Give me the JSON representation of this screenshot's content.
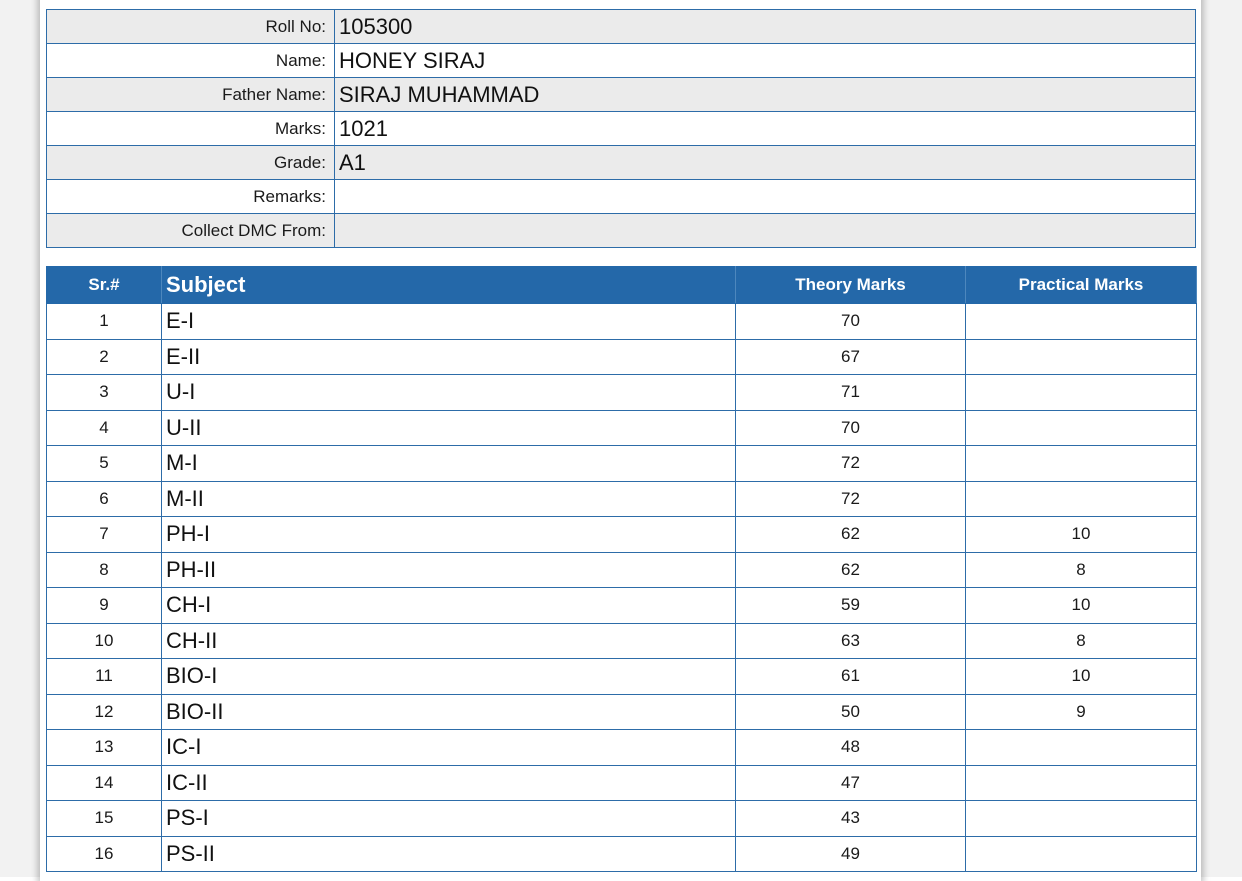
{
  "student": {
    "roll_no_label": "Roll No:",
    "roll_no": "105300",
    "name_label": "Name:",
    "name": "HONEY SIRAJ",
    "father_name_label": "Father Name:",
    "father_name": "SIRAJ MUHAMMAD",
    "marks_label": "Marks:",
    "marks": "1021",
    "grade_label": "Grade:",
    "grade": "A1",
    "remarks_label": "Remarks:",
    "remarks": "",
    "collect_dmc_label": "Collect DMC From:",
    "collect_dmc": ""
  },
  "marks_table": {
    "headers": {
      "sr": "Sr.#",
      "subject": "Subject",
      "theory": "Theory Marks",
      "practical": "Practical Marks"
    },
    "rows": [
      {
        "sr": "1",
        "subject": "E-I",
        "theory": "70",
        "practical": ""
      },
      {
        "sr": "2",
        "subject": "E-II",
        "theory": "67",
        "practical": ""
      },
      {
        "sr": "3",
        "subject": "U-I",
        "theory": "71",
        "practical": ""
      },
      {
        "sr": "4",
        "subject": "U-II",
        "theory": "70",
        "practical": ""
      },
      {
        "sr": "5",
        "subject": "M-I",
        "theory": "72",
        "practical": ""
      },
      {
        "sr": "6",
        "subject": "M-II",
        "theory": "72",
        "practical": ""
      },
      {
        "sr": "7",
        "subject": "PH-I",
        "theory": "62",
        "practical": "10"
      },
      {
        "sr": "8",
        "subject": "PH-II",
        "theory": "62",
        "practical": "8"
      },
      {
        "sr": "9",
        "subject": "CH-I",
        "theory": "59",
        "practical": "10"
      },
      {
        "sr": "10",
        "subject": "CH-II",
        "theory": "63",
        "practical": "8"
      },
      {
        "sr": "11",
        "subject": "BIO-I",
        "theory": "61",
        "practical": "10"
      },
      {
        "sr": "12",
        "subject": "BIO-II",
        "theory": "50",
        "practical": "9"
      },
      {
        "sr": "13",
        "subject": "IC-I",
        "theory": "48",
        "practical": ""
      },
      {
        "sr": "14",
        "subject": "IC-II",
        "theory": "47",
        "practical": ""
      },
      {
        "sr": "15",
        "subject": "PS-I",
        "theory": "43",
        "practical": ""
      },
      {
        "sr": "16",
        "subject": "PS-II",
        "theory": "49",
        "practical": ""
      }
    ]
  },
  "colors": {
    "header_blue": "#2468a9",
    "border_blue": "#2d6ca8",
    "row_gray": "#ebebeb"
  }
}
